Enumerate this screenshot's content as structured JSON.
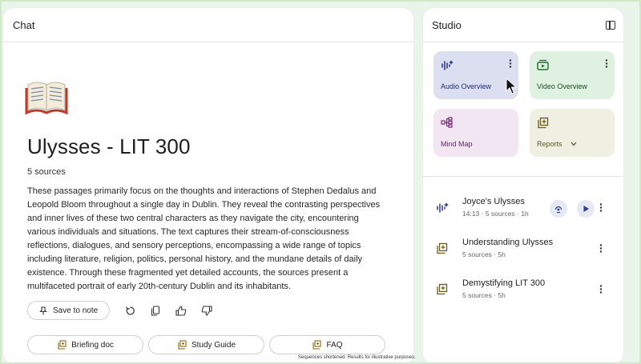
{
  "chat": {
    "header": "Chat",
    "title": "Ulysses - LIT 300",
    "sources_count": "5 sources",
    "summary": "These passages primarily focus on the thoughts and interactions of Stephen Dedalus and Leopold Bloom throughout a single day in Dublin. They reveal the contrasting perspectives and inner lives of these two central characters as they navigate the city, encountering various individuals and situations. The text captures their stream-of-consciousness reflections, dialogues, and sensory perceptions, encompassing a wide range of topics including literature, religion, politics, personal history, and the mundane details of daily existence. Through these fragmented yet detailed accounts, the sources present a multifaceted portrait of early 20th-century Dublin and its inhabitants.",
    "save_to_note": "Save to note",
    "chips": [
      "Briefing doc",
      "Study Guide",
      "FAQ"
    ],
    "footnote": "Sequences shortened. Results for illustrative purposes."
  },
  "studio": {
    "header": "Studio",
    "tiles": {
      "audio": "Audio Overview",
      "video": "Video Overview",
      "mind_map": "Mind Map",
      "reports": "Reports"
    },
    "notes": [
      {
        "title": "Joyce's Ulysses",
        "meta": "14:13 · 5 sources · 1h"
      },
      {
        "title": "Understanding Ulysses",
        "meta": "5 sources · 5h"
      },
      {
        "title": "Demystifying LIT 300",
        "meta": "5 sources · 5h"
      }
    ]
  },
  "colors": {
    "audio_tile": "#dcdff0",
    "video_tile": "#dff1e0",
    "mind_map_tile": "#f1e6f1",
    "reports_tile": "#efefe2"
  }
}
